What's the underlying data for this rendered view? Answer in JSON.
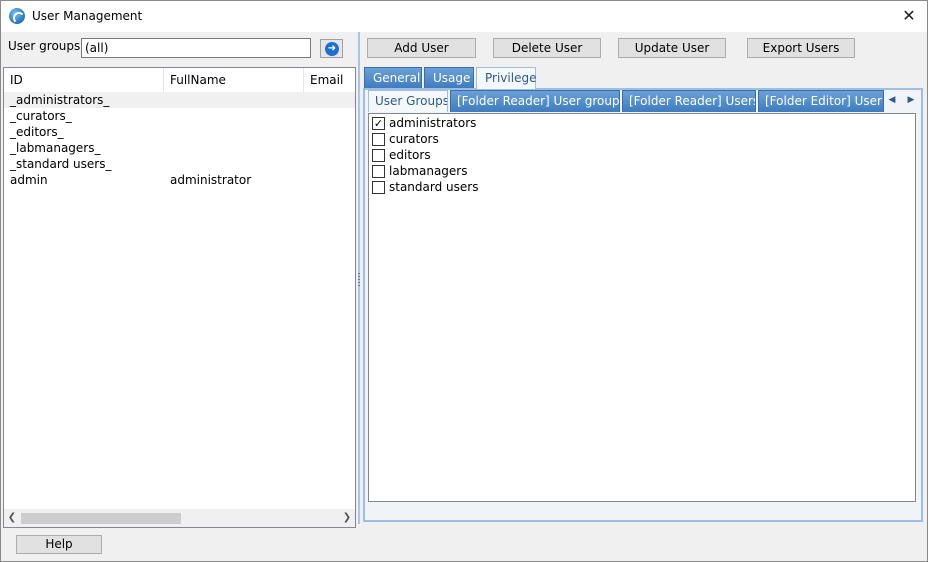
{
  "window": {
    "title": "User Management"
  },
  "left": {
    "user_groups_label": "User groups",
    "user_groups_value": "(all)",
    "columns": [
      "ID",
      "FullName",
      "Email"
    ],
    "rows": [
      {
        "id": "_administrators_",
        "fullname": ""
      },
      {
        "id": "_curators_",
        "fullname": ""
      },
      {
        "id": "_editors_",
        "fullname": ""
      },
      {
        "id": "_labmanagers_",
        "fullname": ""
      },
      {
        "id": "_standard users_",
        "fullname": ""
      },
      {
        "id": "admin",
        "fullname": "administrator"
      }
    ]
  },
  "toolbar": {
    "add": "Add User",
    "delete": "Delete User",
    "update": "Update User",
    "export": "Export Users"
  },
  "outer_tabs": [
    "General",
    "Usage",
    "Privilege"
  ],
  "inner_tabs": [
    "User Groups",
    "[Folder Reader] User groups",
    "[Folder Reader] Users",
    "[Folder Editor] User groups"
  ],
  "groups": [
    {
      "label": "administrators",
      "checked": true
    },
    {
      "label": "curators",
      "checked": false
    },
    {
      "label": "editors",
      "checked": false
    },
    {
      "label": "labmanagers",
      "checked": false
    },
    {
      "label": "standard users",
      "checked": false
    }
  ],
  "footer": {
    "help": "Help"
  }
}
